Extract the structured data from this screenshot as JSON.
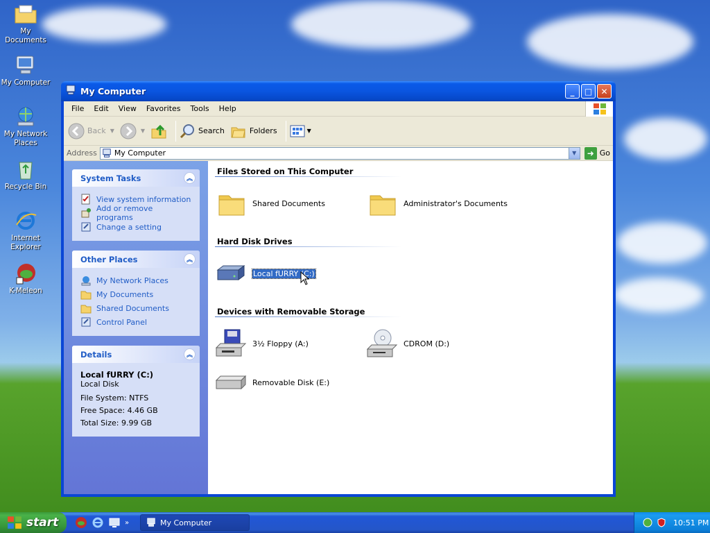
{
  "desktop": {
    "icons": [
      {
        "label": "My Documents",
        "icon": "folder-documents-icon"
      },
      {
        "label": "My Computer",
        "icon": "computer-icon"
      },
      {
        "label": "My Network Places",
        "icon": "network-places-icon"
      },
      {
        "label": "Recycle Bin",
        "icon": "recycle-bin-icon"
      },
      {
        "label": "Internet Explorer",
        "icon": "internet-explorer-icon"
      },
      {
        "label": "K-Meleon",
        "icon": "k-meleon-icon"
      }
    ]
  },
  "window": {
    "title": "My Computer",
    "menu": [
      "File",
      "Edit",
      "View",
      "Favorites",
      "Tools",
      "Help"
    ],
    "toolbar": {
      "back": "Back",
      "search": "Search",
      "folders": "Folders"
    },
    "address": {
      "label": "Address",
      "value": "My Computer",
      "go": "Go"
    },
    "sidebar": {
      "system_tasks": {
        "title": "System Tasks",
        "items": [
          "View system information",
          "Add or remove programs",
          "Change a setting"
        ]
      },
      "other_places": {
        "title": "Other Places",
        "items": [
          "My Network Places",
          "My Documents",
          "Shared Documents",
          "Control Panel"
        ]
      },
      "details": {
        "title": "Details",
        "name": "Local fURRY (C:)",
        "type": "Local Disk",
        "file_system": "File System: NTFS",
        "free_space": "Free Space: 4.46 GB",
        "total_size": "Total Size: 9.99 GB"
      }
    },
    "groups": {
      "files": {
        "title": "Files Stored on This Computer",
        "items": [
          "Shared Documents",
          "Administrator's Documents"
        ]
      },
      "hard_disks": {
        "title": "Hard Disk Drives",
        "items": [
          "Local fURRY (C:)"
        ]
      },
      "removable": {
        "title": "Devices with Removable Storage",
        "items": [
          "3½ Floppy (A:)",
          "CDROM (D:)",
          "Removable Disk (E:)"
        ]
      }
    }
  },
  "taskbar": {
    "start": "start",
    "active_window": "My Computer",
    "clock": "10:51 PM"
  },
  "colors": {
    "title_blue": "#0a5ae8",
    "link_blue": "#215dc6",
    "selection": "#316ac5",
    "start_green": "#3c9a3c"
  }
}
